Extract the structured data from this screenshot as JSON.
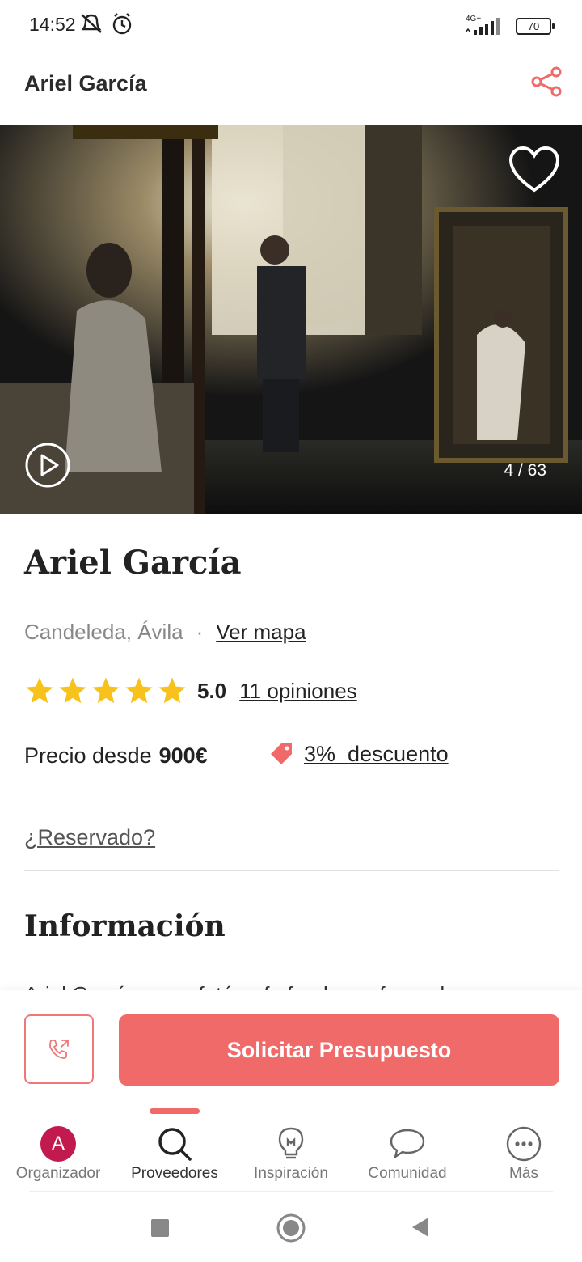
{
  "status_bar": {
    "time": "14:52",
    "network": "4G+",
    "battery": "70"
  },
  "header": {
    "title": "Ariel García",
    "share_icon": "share-icon"
  },
  "gallery": {
    "counter": "4 / 63",
    "favorite_icon": "heart-icon",
    "video_icon": "play-circle-icon"
  },
  "vendor": {
    "name": "Ariel García",
    "location": "Candeleda, Ávila",
    "separator": "·",
    "map_link": "Ver mapa",
    "rating": "5.0",
    "rating_stars": 5,
    "reviews_link": "11 opiniones",
    "price_label": "Precio desde",
    "price_value": "900€",
    "discount_link": "3%  descuento",
    "reserved_link": "¿Reservado?"
  },
  "info": {
    "title": "Información",
    "text": "Ariel García es un fotógrafo freelance formado por"
  },
  "actions": {
    "quote_button": "Solicitar Presupuesto",
    "phone_icon": "phone-call-icon"
  },
  "bottom_nav": {
    "items": [
      {
        "label": "Organizador",
        "icon": "avatar",
        "avatar_letter": "A"
      },
      {
        "label": "Proveedores",
        "icon": "search-icon"
      },
      {
        "label": "Inspiración",
        "icon": "lightbulb-icon"
      },
      {
        "label": "Comunidad",
        "icon": "chat-bubble-icon"
      },
      {
        "label": "Más",
        "icon": "more-icon"
      }
    ],
    "active_index": 1
  },
  "colors": {
    "accent": "#f06a6a",
    "star": "#f8c21c",
    "avatar_bg": "#c21a4e"
  }
}
